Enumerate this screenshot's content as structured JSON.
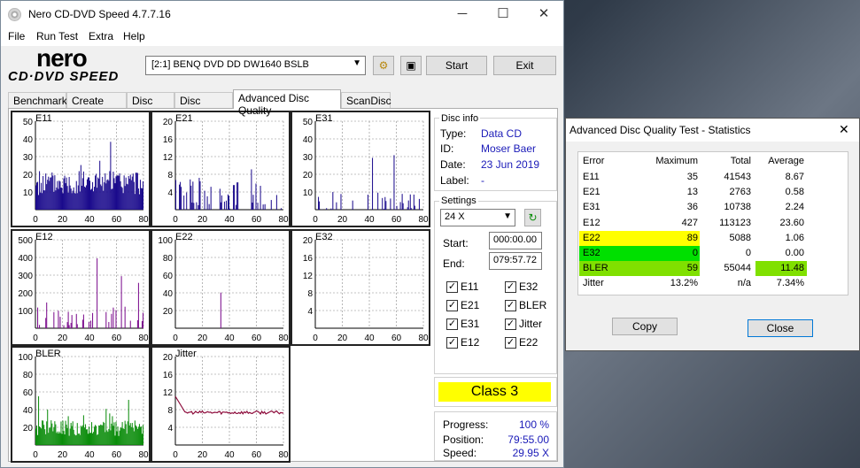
{
  "window": {
    "title": "Nero CD-DVD Speed 4.7.7.16",
    "minimize": "─",
    "maximize": "☐",
    "close": "✕"
  },
  "menu": [
    "File",
    "Run Test",
    "Extra",
    "Help"
  ],
  "logo": {
    "nero": "nero",
    "cd": "CD·DVD SPEED"
  },
  "drive": {
    "selected": "[2:1]   BENQ DVD DD DW1640 BSLB"
  },
  "toolbar": {
    "start": "Start",
    "exit": "Exit"
  },
  "tabs": [
    "Benchmark",
    "Create Disc",
    "Disc Info",
    "Disc Quality",
    "Advanced Disc Quality",
    "ScanDisc"
  ],
  "active_tab": "Advanced Disc Quality",
  "disc_info": {
    "header": "Disc info",
    "type_label": "Type:",
    "type": "Data CD",
    "id_label": "ID:",
    "id": "Moser Baer",
    "date_label": "Date:",
    "date": "23 Jun 2019",
    "label_label": "Label:",
    "label": "-"
  },
  "settings": {
    "header": "Settings",
    "speed": "24 X",
    "start_label": "Start:",
    "start": "000:00.00",
    "end_label": "End:",
    "end": "079:57.72"
  },
  "checks": [
    {
      "label": "E11",
      "checked": true
    },
    {
      "label": "E32",
      "checked": true
    },
    {
      "label": "E21",
      "checked": true
    },
    {
      "label": "BLER",
      "checked": true
    },
    {
      "label": "E31",
      "checked": true
    },
    {
      "label": "Jitter",
      "checked": true
    },
    {
      "label": "E12",
      "checked": true
    },
    {
      "label": "E22",
      "checked": true
    }
  ],
  "class": {
    "text": "Class 3",
    "color": "#ffff00"
  },
  "progress": {
    "progress_label": "Progress:",
    "progress": "100 %",
    "position_label": "Position:",
    "position": "79:55.00",
    "speed_label": "Speed:",
    "speed": "29.95 X"
  },
  "chart_data": [
    {
      "type": "bar",
      "title": "E11",
      "color": "#1a0a8c",
      "ylim": [
        0,
        50
      ],
      "yticks": [
        10,
        20,
        30,
        40,
        50
      ],
      "xticks": [
        0,
        20,
        40,
        60,
        80
      ],
      "grid": true
    },
    {
      "type": "bar",
      "title": "E21",
      "color": "#1a0a8c",
      "ylim": [
        0,
        20
      ],
      "yticks": [
        4,
        8,
        12,
        16,
        20
      ],
      "xticks": [
        0,
        20,
        40,
        60,
        80
      ],
      "grid": true
    },
    {
      "type": "bar",
      "title": "E31",
      "color": "#1a0a8c",
      "ylim": [
        0,
        50
      ],
      "yticks": [
        10,
        20,
        30,
        40,
        50
      ],
      "xticks": [
        0,
        20,
        40,
        60,
        80
      ],
      "grid": true
    },
    {
      "type": "bar",
      "title": "E12",
      "color": "#7a0a8c",
      "ylim": [
        0,
        500
      ],
      "yticks": [
        100,
        200,
        300,
        400,
        500
      ],
      "xticks": [
        0,
        20,
        40,
        60,
        80
      ],
      "grid": true
    },
    {
      "type": "bar",
      "title": "E22",
      "color": "#7a0a8c",
      "ylim": [
        0,
        100
      ],
      "yticks": [
        20,
        40,
        60,
        80,
        100
      ],
      "xticks": [
        0,
        20,
        40,
        60,
        80
      ],
      "grid": true
    },
    {
      "type": "bar",
      "title": "E32",
      "color": "#7a0a8c",
      "ylim": [
        0,
        20
      ],
      "yticks": [
        4,
        8,
        12,
        16,
        20
      ],
      "xticks": [
        0,
        20,
        40,
        60,
        80
      ],
      "grid": true
    },
    {
      "type": "bar",
      "title": "BLER",
      "color": "#0a8c0a",
      "ylim": [
        0,
        100
      ],
      "yticks": [
        20,
        40,
        60,
        80,
        100
      ],
      "xticks": [
        0,
        20,
        40,
        60,
        80
      ],
      "grid": true
    },
    {
      "type": "line",
      "title": "Jitter",
      "color": "#8c0a3a",
      "ylim": [
        0,
        20
      ],
      "yticks": [
        4,
        8,
        12,
        16,
        20
      ],
      "xticks": [
        0,
        20,
        40,
        60,
        80
      ],
      "grid": true
    }
  ],
  "stats": {
    "title": "Advanced Disc Quality Test - Statistics",
    "headers": [
      "Error",
      "Maximum",
      "Total",
      "Average"
    ],
    "rows": [
      {
        "name": "E11",
        "max": "35",
        "total": "41543",
        "avg": "8.67"
      },
      {
        "name": "E21",
        "max": "13",
        "total": "2763",
        "avg": "0.58"
      },
      {
        "name": "E31",
        "max": "36",
        "total": "10738",
        "avg": "2.24"
      },
      {
        "name": "E12",
        "max": "427",
        "total": "113123",
        "avg": "23.60"
      },
      {
        "name": "E22",
        "max": "89",
        "total": "5088",
        "avg": "1.06"
      },
      {
        "name": "E32",
        "max": "0",
        "total": "0",
        "avg": "0.00"
      },
      {
        "name": "BLER",
        "max": "59",
        "total": "55044",
        "avg": "11.48"
      },
      {
        "name": "Jitter",
        "max": "13.2%",
        "total": "n/a",
        "avg": "7.34%"
      }
    ],
    "copy": "Copy",
    "close": "Close",
    "highlight_yellow": "#ffff00",
    "highlight_green": "#00e000",
    "highlight_lime": "#80e000"
  }
}
